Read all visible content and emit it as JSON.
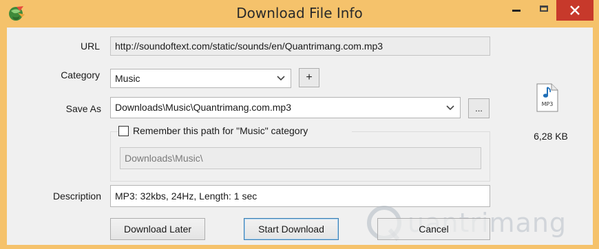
{
  "window": {
    "title": "Download File Info",
    "frame_color": "#f5c26b",
    "close_color": "#c7392b"
  },
  "form": {
    "url_label": "URL",
    "url_value": "http://soundoftext.com/static/sounds/en/Quantrimang.com.mp3",
    "category_label": "Category",
    "category_value": "Music",
    "add_category_label": "+",
    "save_as_label": "Save As",
    "save_as_value": "Downloads\\Music\\Quantrimang.com.mp3",
    "browse_label": "...",
    "remember_label": "Remember this path for \"Music\" category",
    "remember_checked": false,
    "remembered_path": "Downloads\\Music\\",
    "description_label": "Description",
    "description_value": "MP3: 32kbs, 24Hz, Length: 1 sec"
  },
  "file_info": {
    "icon": "mp3-file-icon",
    "icon_text": "MP3",
    "size": "6,28 KB"
  },
  "buttons": {
    "download_later": "Download Later",
    "start_download": "Start Download",
    "cancel": "Cancel"
  },
  "watermark": {
    "text": "uantrimang"
  }
}
